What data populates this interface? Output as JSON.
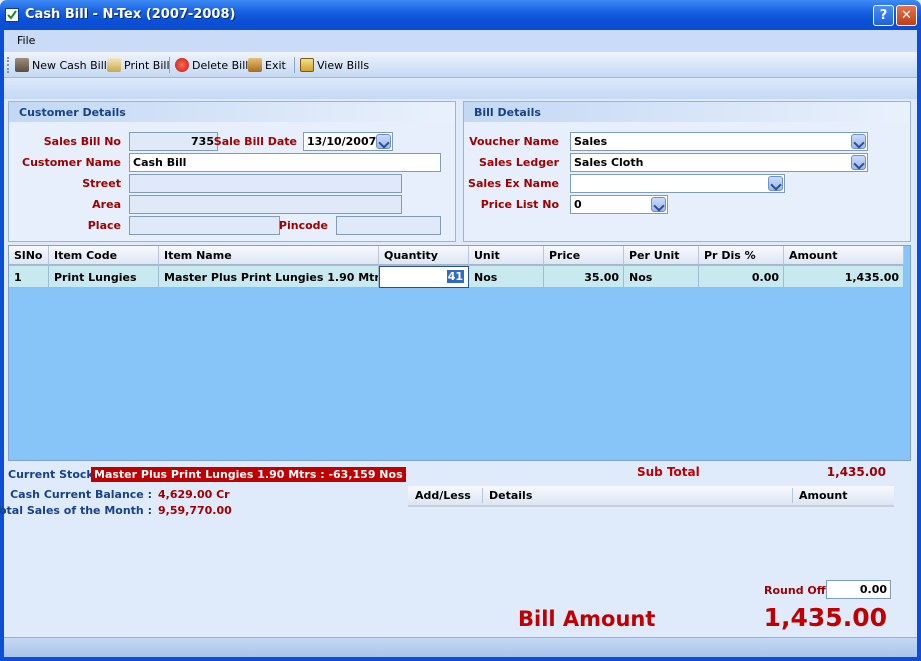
{
  "window": {
    "title": "Cash Bill - N-Tex (2007-2008)",
    "help_label": "?",
    "close_label": "✕",
    "icon": "checkmark-app-icon"
  },
  "menu": {
    "file_label": "File"
  },
  "toolbar": {
    "new_label": "New Cash Bill",
    "print_label": "Print Bill",
    "delete_label": "Delete Bill",
    "exit_label": "Exit",
    "view_label": "View Bills"
  },
  "customer": {
    "heading": "Customer Details",
    "bill_no_label": "Sales Bill No",
    "bill_no": "735",
    "date_label": "Sale Bill Date",
    "date": "13/10/2007",
    "name_label": "Customer Name",
    "name": "Cash Bill",
    "street_label": "Street",
    "street": "",
    "area_label": "Area",
    "area": "",
    "place_label": "Place",
    "place": "",
    "pincode_label": "Pincode",
    "pincode": ""
  },
  "bill": {
    "heading": "Bill Details",
    "voucher_label": "Voucher Name",
    "voucher": "Sales",
    "ledger_label": "Sales Ledger",
    "ledger": "Sales Cloth",
    "ex_label": "Sales Ex Name",
    "ex": "",
    "pricelist_label": "Price List No",
    "pricelist": "0"
  },
  "grid": {
    "headers": [
      "SlNo",
      "Item Code",
      "Item Name",
      "Quantity",
      "Unit",
      "Price",
      "Per Unit",
      "Pr Dis %",
      "Amount"
    ],
    "rows": [
      {
        "slno": "1",
        "code": "Print Lungies",
        "name": "Master Plus Print Lungies 1.90 Mtrs",
        "qty": "41",
        "unit": "Nos",
        "price": "35.00",
        "per_unit": "Nos",
        "discount": "0.00",
        "amount": "1,435.00"
      }
    ]
  },
  "footer": {
    "stock_label": "Current Stock",
    "stock_value": "Master Plus Print Lungies 1.90 Mtrs : -63,159 Nos",
    "balance_label": "Cash Current Balance :",
    "balance_value": "4,629.00 Cr",
    "month_label": "Total Sales of the Month :",
    "month_value": "9,59,770.00",
    "subtotal_label": "Sub Total",
    "subtotal_value": "1,435.00",
    "addless_headers": [
      "Add/Less",
      "Details",
      "Amount"
    ],
    "roundoff_label": "Round Off",
    "roundoff_value": "0.00",
    "bill_amount_label": "Bill Amount",
    "bill_amount_value": "1,435.00"
  },
  "colors": {
    "accent": "#0a4fd6",
    "label_red": "#a00000",
    "grid_bg": "#87c5f8",
    "stock_bg": "#c00000"
  }
}
